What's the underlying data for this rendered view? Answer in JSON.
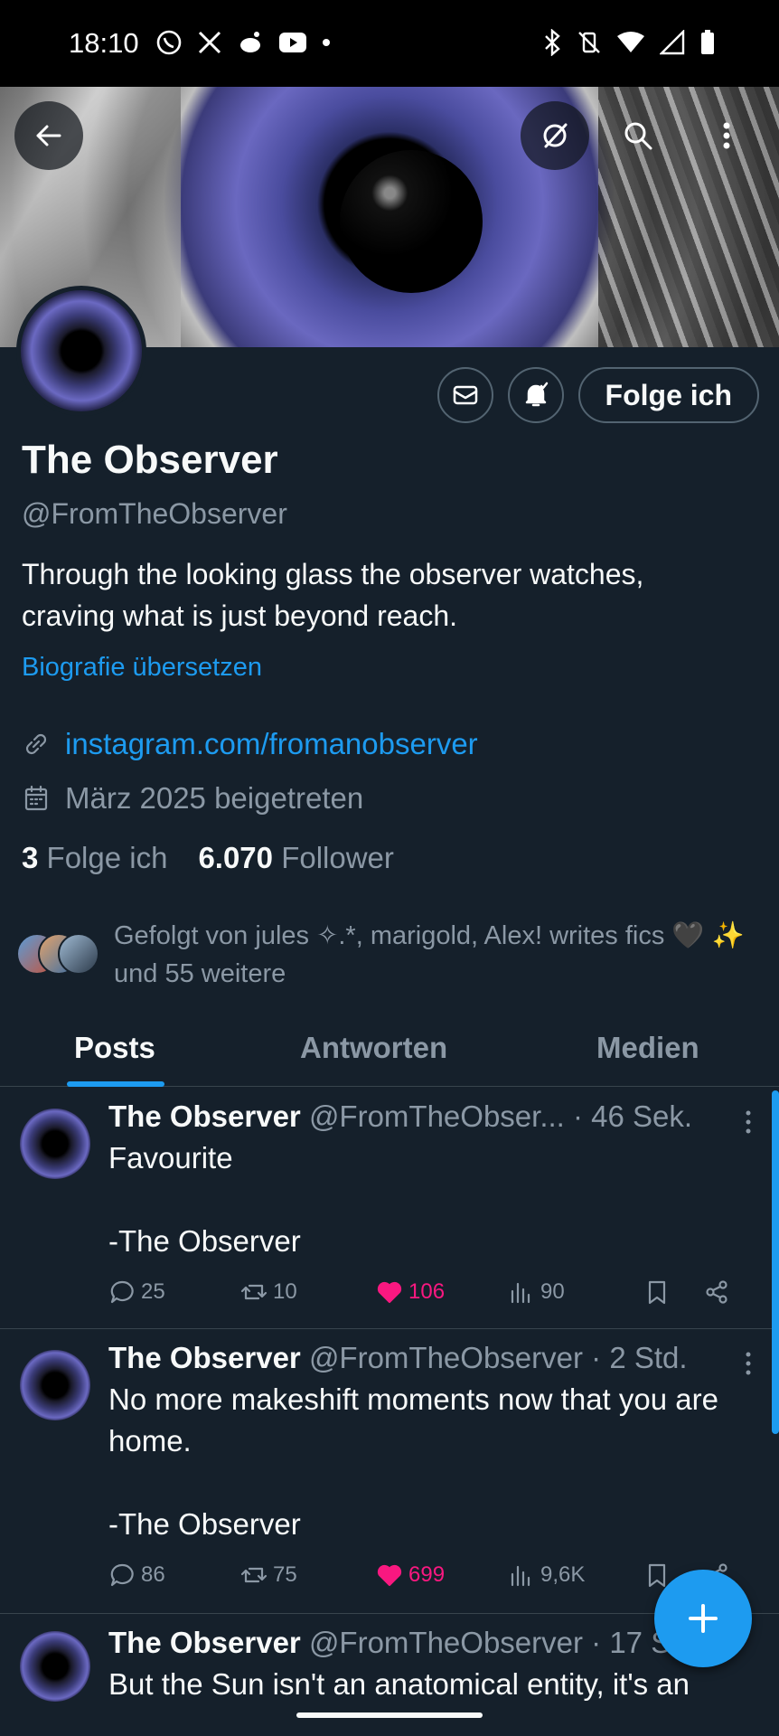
{
  "status_bar": {
    "time": "18:10",
    "notification_icons": [
      "whatsapp-icon",
      "x-icon",
      "reddit-icon",
      "youtube-icon",
      "dot-icon"
    ],
    "system_icons": [
      "bluetooth-icon",
      "vibrate-off-icon",
      "wifi-icon",
      "signal-icon",
      "battery-icon"
    ]
  },
  "header": {
    "buttons": [
      "back-icon",
      "feed-off-icon",
      "search-icon",
      "more-vertical-icon"
    ]
  },
  "profile": {
    "name": "The Observer",
    "handle": "@FromTheObserver",
    "bio": "Through the looking glass the observer watches, craving what is just beyond reach.",
    "translate_bio": "Biografie übersetzen",
    "link": "instagram.com/fromanobserver",
    "joined": "März 2025 beigetreten",
    "following_count": "3",
    "following_label": "Folge ich",
    "followers_count": "6.070",
    "followers_label": "Follower",
    "followed_by": "Gefolgt von jules ✧.*, marigold, Alex! writes fics 🖤 ✨ und 55 weitere",
    "follow_button": "Folge ich",
    "accent_color": "#1d9bf0"
  },
  "tabs": [
    {
      "label": "Posts",
      "active": true
    },
    {
      "label": "Antworten",
      "active": false
    },
    {
      "label": "Medien",
      "active": false
    }
  ],
  "posts": [
    {
      "name": "The Observer",
      "handle": "@FromTheObser...",
      "time": "· 46 Sek.",
      "text": "Favourite\n\n-The Observer",
      "replies": "25",
      "reposts": "10",
      "likes": "106",
      "views": "90"
    },
    {
      "name": "The Observer",
      "handle": "@FromTheObserver",
      "time": "· 2 Std.",
      "text": "No more makeshift moments now that you are home.\n\n-The Observer",
      "replies": "86",
      "reposts": "75",
      "likes": "699",
      "views": "9,6K"
    },
    {
      "name": "The Observer",
      "handle": "@FromTheObserver",
      "time": "· 17 S",
      "text": "But the Sun isn't an anatomical entity, it's an"
    }
  ]
}
